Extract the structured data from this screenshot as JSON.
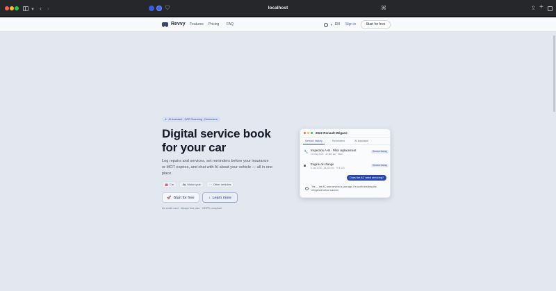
{
  "browser": {
    "url": "localhost",
    "icons": {
      "sidebar": "sidebar-icon",
      "back": "‹",
      "forward": "›",
      "share": "⇪",
      "new_tab": "+",
      "translate": "⌘"
    }
  },
  "nav": {
    "brand": "Revvy",
    "links": [
      "Features",
      "Pricing",
      "FAQ"
    ],
    "language": "EN",
    "sign_in": "Sign in",
    "cta": "Start for free"
  },
  "hero": {
    "badge": "AI Assistant · OCR Scanning · Reminders",
    "title_line1": "Digital service book",
    "title_line2": "for your car",
    "description": "Log repairs and services, set reminders before your insurance or MOT expires, and chat with AI about your vehicle — all in one place.",
    "chips": [
      "Car",
      "Motorcycle",
      "Other vehicles"
    ],
    "primary_button": "Start for free",
    "secondary_button": "Learn more",
    "fine_print": "No credit card · Always free plan · GDPR compliant"
  },
  "card": {
    "title": "2022 Renault Mégane",
    "tabs": [
      "Service history",
      "Reminders",
      "AI Assistant"
    ],
    "active_tab": 0,
    "entries": [
      {
        "title": "Inspection A+B · Filter replacement",
        "meta": "12 May 2026 · 42,800 km · €520",
        "tag": "Service history",
        "icon": "🔧"
      },
      {
        "title": "Engine oil change",
        "meta": "5 Jan 2026 · 38,200 km · 75 € 120",
        "tag": "Service history",
        "icon": "◙"
      }
    ],
    "chat_question": "Does the AC need servicing?",
    "chat_answer": "Yes — the AC was serviced a year ago. It's worth checking the refrigerant before summer."
  },
  "colors": {
    "page_bg": "#e3e8f0",
    "accent": "#2947a8",
    "chrome_bg": "#26272b"
  }
}
